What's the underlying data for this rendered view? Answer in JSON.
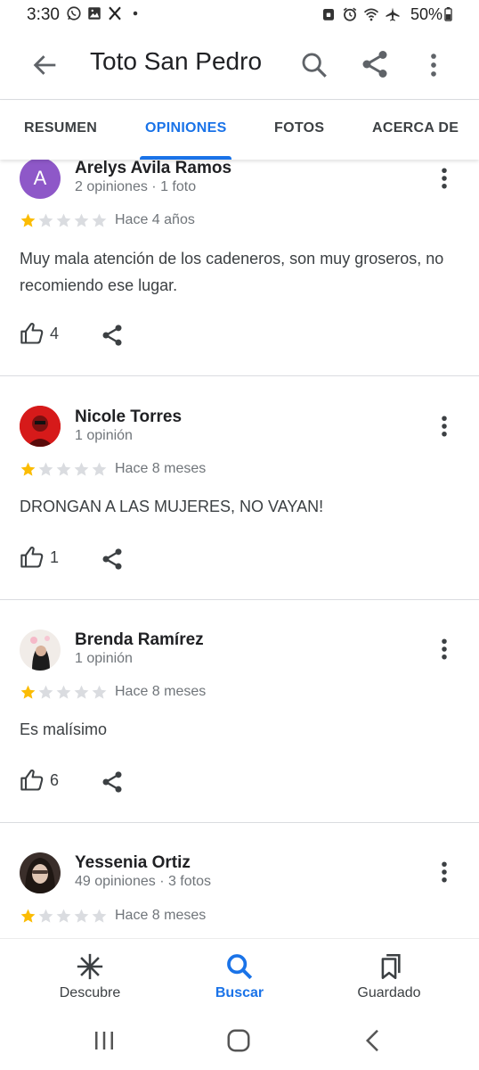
{
  "status_bar": {
    "time": "3:30",
    "battery": "50%",
    "left_icons": [
      "whatsapp-icon",
      "gallery-icon",
      "x-icon",
      "dot-icon"
    ],
    "right_icons": [
      "lock-icon",
      "alarm-icon",
      "wifi-icon",
      "airplane-icon",
      "battery-icon"
    ]
  },
  "app_bar": {
    "title": "Toto San Pedro"
  },
  "tabs": [
    {
      "label": "RESUMEN",
      "active": false
    },
    {
      "label": "OPINIONES",
      "active": true
    },
    {
      "label": "FOTOS",
      "active": false
    },
    {
      "label": "ACERCA DE",
      "active": false
    }
  ],
  "colors": {
    "accent": "#1a73e8",
    "star_filled": "#fbbc04",
    "star_empty": "#dadce0",
    "avatar_letter_bg": "#8e58c8"
  },
  "reviews": [
    {
      "name": "Arelys Avila Ramos",
      "meta": "2 opiniones · 1 foto",
      "avatar_letter": "A",
      "rating": 1,
      "date": "Hace 4 años",
      "text": "Muy mala atención de los cadeneros, son muy groseros, no recomiendo ese lugar.",
      "likes": "4"
    },
    {
      "name": "Nicole Torres",
      "meta": "1 opinión",
      "avatar_letter": "",
      "rating": 1,
      "date": "Hace 8 meses",
      "text": "DRONGAN A LAS MUJERES, NO VAYAN!",
      "likes": "1"
    },
    {
      "name": "Brenda Ramírez",
      "meta": "1 opinión",
      "avatar_letter": "",
      "rating": 1,
      "date": "Hace 8 meses",
      "text": "Es malísimo",
      "likes": "6"
    },
    {
      "name": "Yessenia Ortiz",
      "meta": "49 opiniones · 3 fotos",
      "avatar_letter": "",
      "rating": 1,
      "date": "Hace 8 meses",
      "text": "",
      "likes": ""
    }
  ],
  "bottom_nav": [
    {
      "label": "Descubre",
      "icon": "asterisk-icon",
      "active": false
    },
    {
      "label": "Buscar",
      "icon": "search-icon",
      "active": true
    },
    {
      "label": "Guardado",
      "icon": "bookmarks-icon",
      "active": false
    }
  ],
  "system_nav": [
    "recents-icon",
    "home-icon",
    "back-icon"
  ]
}
